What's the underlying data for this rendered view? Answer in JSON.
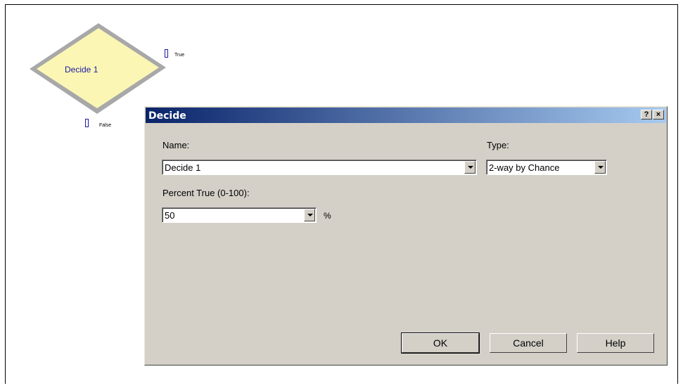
{
  "diagram": {
    "module_label": "Decide 1",
    "true_label": "True",
    "false_label": "False"
  },
  "dialog": {
    "title": "Decide",
    "help_glyph": "?",
    "close_glyph": "×",
    "name_label": "Name:",
    "name_value": "Decide 1",
    "type_label": "Type:",
    "type_value": "2-way by Chance",
    "percent_label": "Percent True (0-100):",
    "percent_value": "50",
    "percent_unit": "%",
    "ok_label": "OK",
    "cancel_label": "Cancel",
    "help_label": "Help"
  },
  "colors": {
    "title_gradient_start": "#0a246a",
    "title_gradient_end": "#a6caf0",
    "dialog_face": "#d4d0c8",
    "diamond_fill": "#fbf6b4",
    "diamond_border": "#a8a8a8"
  },
  "icons": {
    "diamond": "decide-diamond-icon",
    "dropdown": "chevron-down-icon"
  }
}
